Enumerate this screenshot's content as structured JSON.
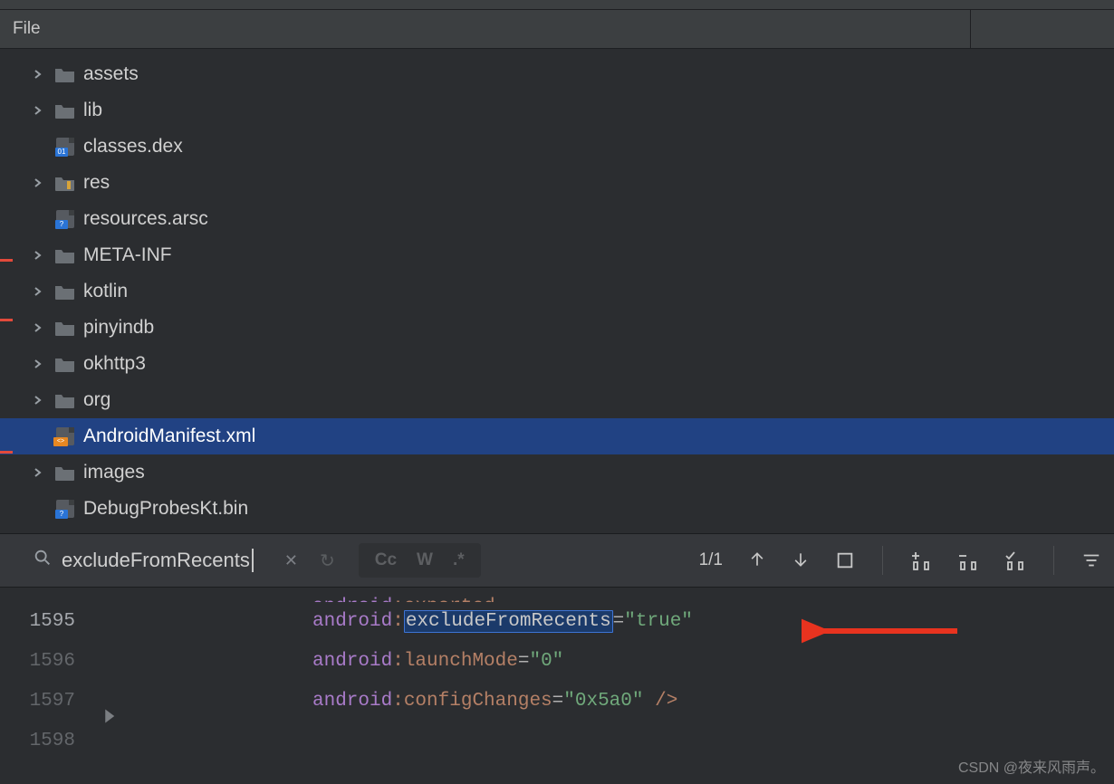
{
  "header": {
    "file_col": "File"
  },
  "tree": {
    "items": [
      {
        "chev": true,
        "icon": "folder",
        "label": "assets",
        "selected": false
      },
      {
        "chev": true,
        "icon": "folder",
        "label": "lib",
        "selected": false
      },
      {
        "chev": false,
        "icon": "binfile",
        "label": "classes.dex",
        "selected": false,
        "tag": "01"
      },
      {
        "chev": true,
        "icon": "folder-res",
        "label": "res",
        "selected": false
      },
      {
        "chev": false,
        "icon": "binfile",
        "label": "resources.arsc",
        "selected": false,
        "tag": "?"
      },
      {
        "chev": true,
        "icon": "folder",
        "label": "META-INF",
        "selected": false
      },
      {
        "chev": true,
        "icon": "folder",
        "label": "kotlin",
        "selected": false
      },
      {
        "chev": true,
        "icon": "folder",
        "label": "pinyindb",
        "selected": false
      },
      {
        "chev": true,
        "icon": "folder",
        "label": "okhttp3",
        "selected": false
      },
      {
        "chev": true,
        "icon": "folder",
        "label": "org",
        "selected": false
      },
      {
        "chev": false,
        "icon": "xmlfile",
        "label": "AndroidManifest.xml",
        "selected": true,
        "tag": "<>"
      },
      {
        "chev": true,
        "icon": "folder",
        "label": "images",
        "selected": false
      },
      {
        "chev": false,
        "icon": "binfile",
        "label": "DebugProbesKt.bin",
        "selected": false,
        "tag": "?"
      }
    ]
  },
  "search": {
    "query": "excludeFromRecents",
    "close_tooltip": "Close",
    "history_tooltip": "History",
    "opt_case": "Cc",
    "opt_word": "W",
    "opt_regex": ".*",
    "match_count": "1/1",
    "btn_prev": "Previous Occurrence",
    "btn_next": "Next Occurrence",
    "btn_select": "Select All Occurrences",
    "btn_addsel": "Add Selection",
    "btn_remsel": "Remove Selection",
    "btn_checksel": "Toggle Selection",
    "btn_filter": "Filter"
  },
  "editor": {
    "above_line_no": "",
    "lines": [
      {
        "no": "1595",
        "ns": "android",
        "attr": "excludeFromRecents",
        "val": "\"true\"",
        "highlight": true,
        "close": ""
      },
      {
        "no": "1596",
        "ns": "android",
        "attr": "launchMode",
        "val": "\"0\"",
        "highlight": false,
        "close": ""
      },
      {
        "no": "1597",
        "ns": "android",
        "attr": "configChanges",
        "val": "\"0x5a0\"",
        "highlight": false,
        "close": " />"
      }
    ],
    "trailing_no": "1598",
    "partial_above": {
      "ns": "android",
      "sep": ":",
      "attr_hint": "exported",
      "val_hint": "false"
    }
  },
  "watermark": "CSDN @夜来风雨声。"
}
